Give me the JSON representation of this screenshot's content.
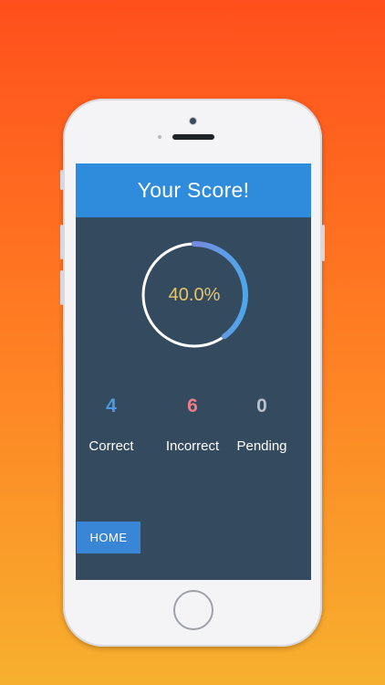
{
  "screen": {
    "title": "Your Score!",
    "score": {
      "label": "40.0%",
      "fraction": 0.4
    },
    "stats": [
      {
        "value": "4",
        "label": "Correct",
        "color": "#4a9be3"
      },
      {
        "value": "6",
        "label": "Incorrect",
        "color": "#ee7e86"
      },
      {
        "value": "0",
        "label": "Pending",
        "color": "#b9c2cc"
      }
    ],
    "home_button": "HOME"
  },
  "colors": {
    "header_bg": "#2f8bdc",
    "screen_bg": "#344a5f",
    "progress_gradient": [
      "#4fa6ea",
      "#9d6fd6"
    ],
    "ring_track": "#ffffff",
    "score_text": "#e9c56a"
  }
}
